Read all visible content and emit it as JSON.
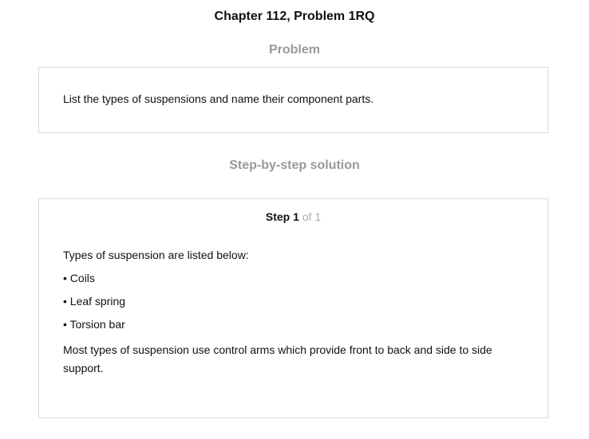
{
  "page": {
    "title": "Chapter 112, Problem 1RQ"
  },
  "problem": {
    "heading": "Problem",
    "text": "List the types of suspensions and name their component parts."
  },
  "solution": {
    "heading": "Step-by-step solution",
    "step": {
      "label": "Step 1",
      "of_text": " of 1",
      "intro": "Types of suspension are listed below:",
      "items": [
        "• Coils",
        "• Leaf spring",
        "• Torsion bar"
      ],
      "conclusion": "Most types of suspension use control arms which provide front to back and side to side support."
    }
  }
}
